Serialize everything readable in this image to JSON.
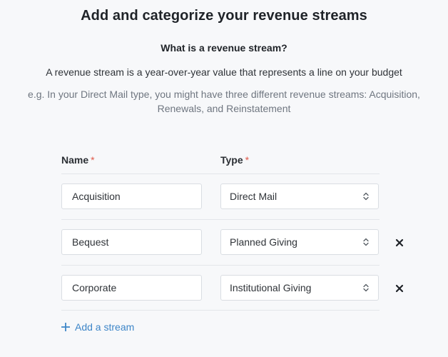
{
  "header": {
    "title": "Add and categorize your revenue streams",
    "subtitle": "What is a revenue stream?",
    "description": "A revenue stream is a year-over-year value that represents a line on your budget",
    "example": "e.g. In your Direct Mail type, you might have three different revenue streams: Acquisition, Renewals, and Reinstatement"
  },
  "columns": {
    "name_label": "Name",
    "type_label": "Type",
    "required_mark": "*"
  },
  "streams": [
    {
      "name": "Acquisition",
      "type": "Direct Mail",
      "removable": false
    },
    {
      "name": "Bequest",
      "type": "Planned Giving",
      "removable": true
    },
    {
      "name": "Corporate",
      "type": "Institutional Giving",
      "removable": true
    }
  ],
  "actions": {
    "add_stream_label": "Add a stream"
  },
  "icons": {
    "select": "chevron-up-down-icon",
    "remove": "close-icon",
    "add": "plus-icon"
  },
  "colors": {
    "background": "#f7f8fa",
    "required": "#e05a4a",
    "link": "#3e86c8",
    "divider": "#e3e6ea"
  }
}
